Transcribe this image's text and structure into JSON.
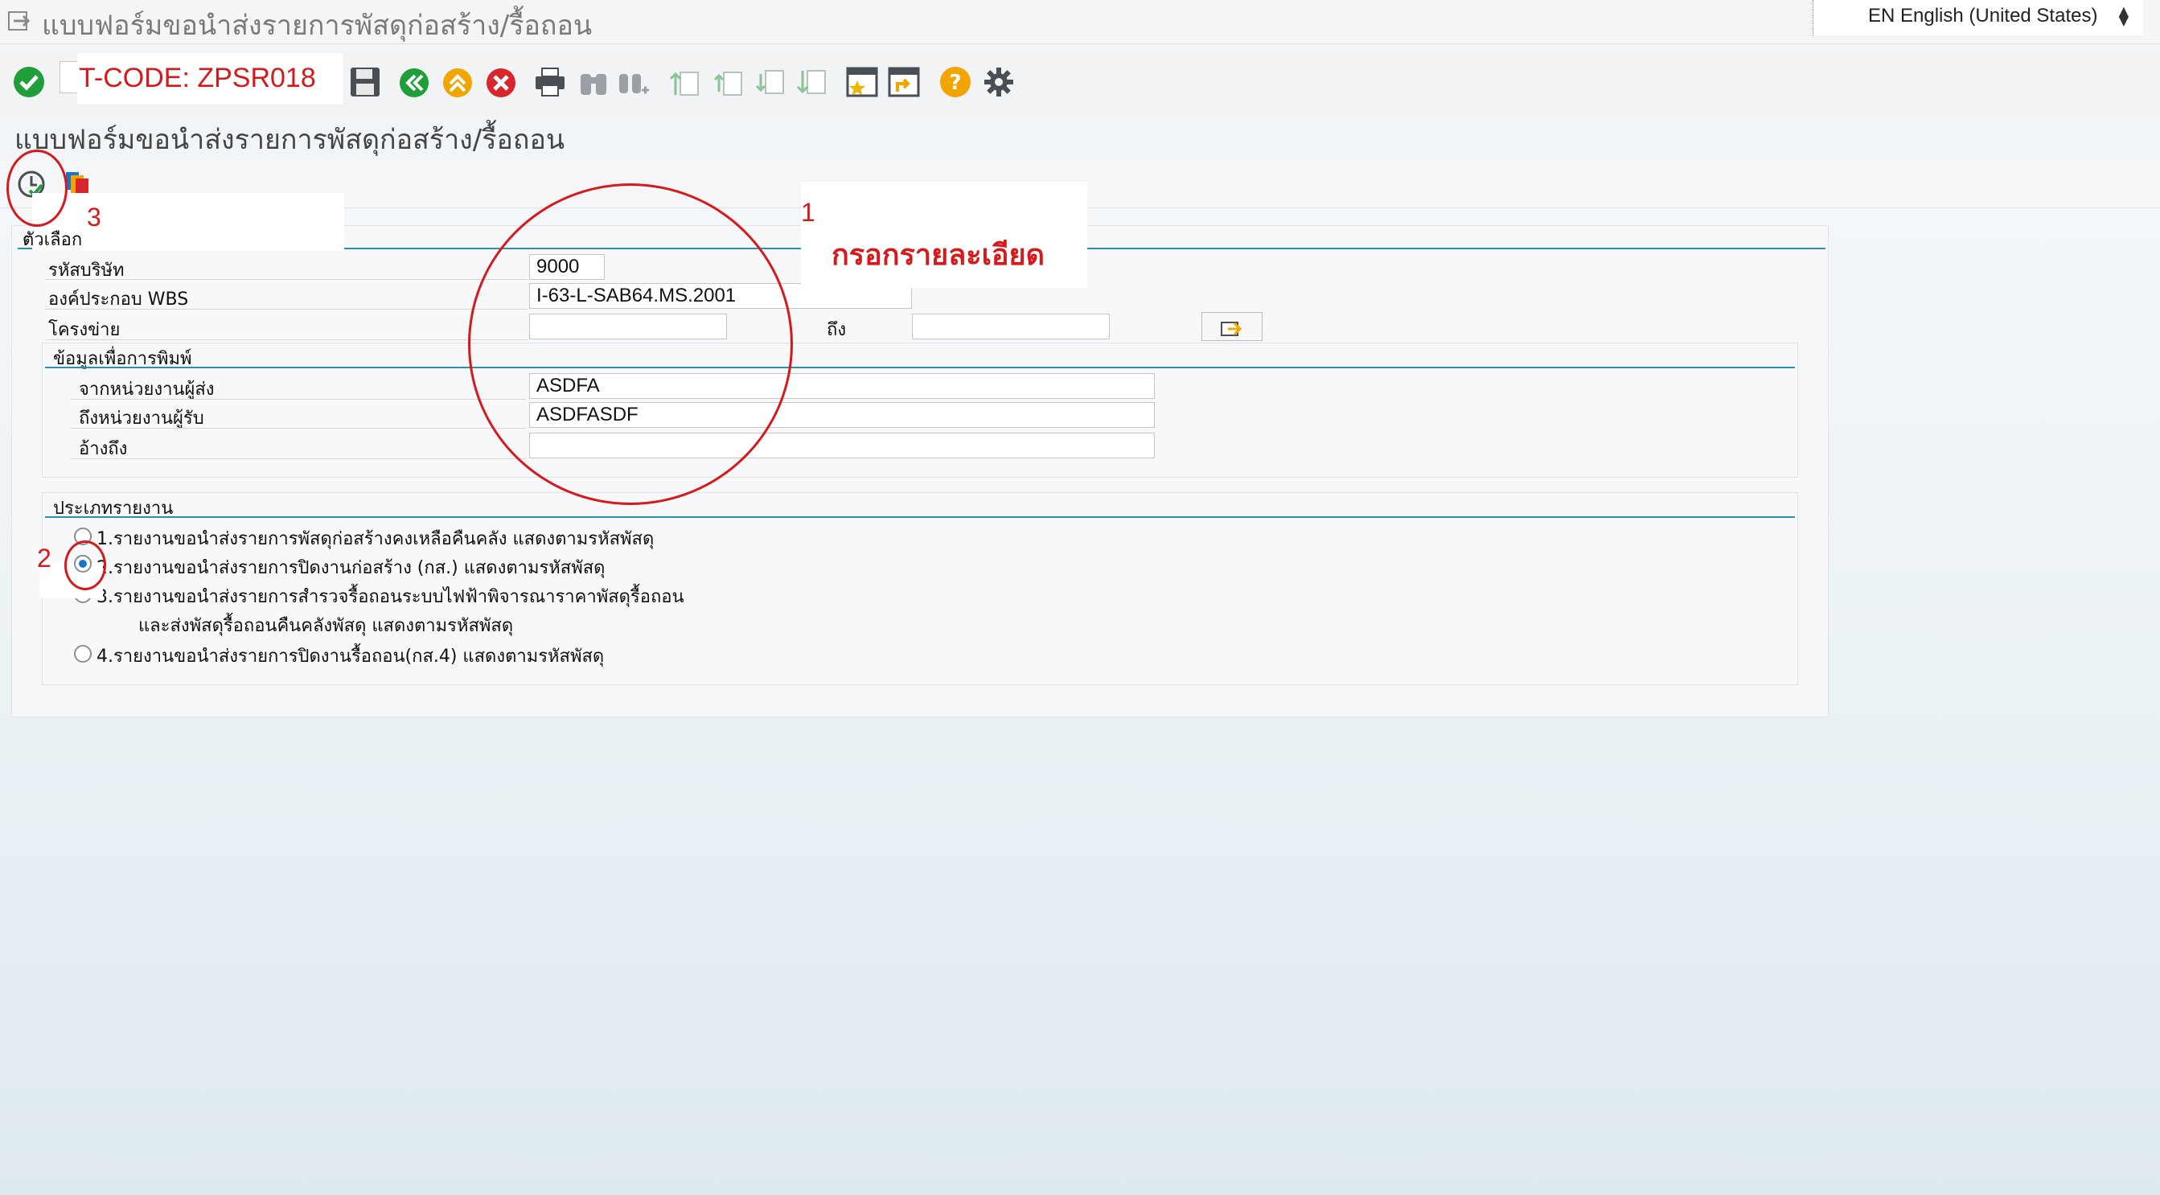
{
  "window": {
    "title": "แบบฟอร์มขอนำส่งรายการพัสดุก่อสร้าง/รื้อถอน",
    "language": "EN English (United States)"
  },
  "toolbar": {
    "tcode_label": "T-CODE: ZPSR018",
    "icons": [
      "enter-check",
      "save",
      "back",
      "exit",
      "cancel",
      "print",
      "find",
      "find-next",
      "first-page",
      "previous-page",
      "next-page",
      "last-page",
      "create-session",
      "shortcut",
      "help",
      "customize-layout"
    ]
  },
  "screen": {
    "title": "แบบฟอร์มขอนำส่งรายการพัสดุก่อสร้าง/รื้อถอน"
  },
  "selection": {
    "group_title": "ตัวเลือก",
    "company_code_label": "รหัสบริษัท",
    "company_code_value": "9000",
    "wbs_label": "องค์ประกอบ WBS",
    "wbs_value": "I-63-L-SAB64.MS.2001",
    "network_label": "โครงข่าย",
    "network_value": "",
    "to_label": "ถึง",
    "to_value": ""
  },
  "print_info": {
    "group_title": "ข้อมูลเพื่อการพิมพ์",
    "from_label": "จากหน่วยงานผู้ส่ง",
    "from_value": "ASDFA",
    "to_label": "ถึงหน่วยงานผู้รับ",
    "to_value": "ASDFASDF",
    "ref_label": "อ้างถึง",
    "ref_value": ""
  },
  "report_type": {
    "group_title": "ประเภทรายงาน",
    "options": [
      {
        "label": "1.รายงานขอนำส่งรายการพัสดุก่อสร้างคงเหลือคืนคลัง  แสดงตามรหัสพัสดุ",
        "selected": false
      },
      {
        "label": "2.รายงานขอนำส่งรายการปิดงานก่อสร้าง (กส.) แสดงตามรหัสพัสดุ",
        "selected": true
      },
      {
        "label": "3.รายงานขอนำส่งรายการสำรวจรื้อถอนระบบไฟฟ้าพิจารณาราคาพัสดุรื้อถอน",
        "label_line2": "และส่งพัสดุรื้อถอนคืนคลังพัสดุ แสดงตามรหัสพัสดุ",
        "selected": false
      },
      {
        "label": "4.รายงานขอนำส่งรายการปิดงานรื้อถอน(กส.4) แสดงตามรหัสพัสดุ",
        "selected": false
      }
    ]
  },
  "annotations": {
    "step1_number": "1",
    "step1_text": "กรอกรายละเอียด",
    "step2_number": "2",
    "step3_number": "3",
    "color": "#d7191c"
  },
  "colors": {
    "group_line": "#2d8fab",
    "radio_selected": "#1b74c5",
    "ok_green": "#1f9e3a",
    "cancel_red": "#d9262c",
    "exit_orange": "#f0a500"
  }
}
